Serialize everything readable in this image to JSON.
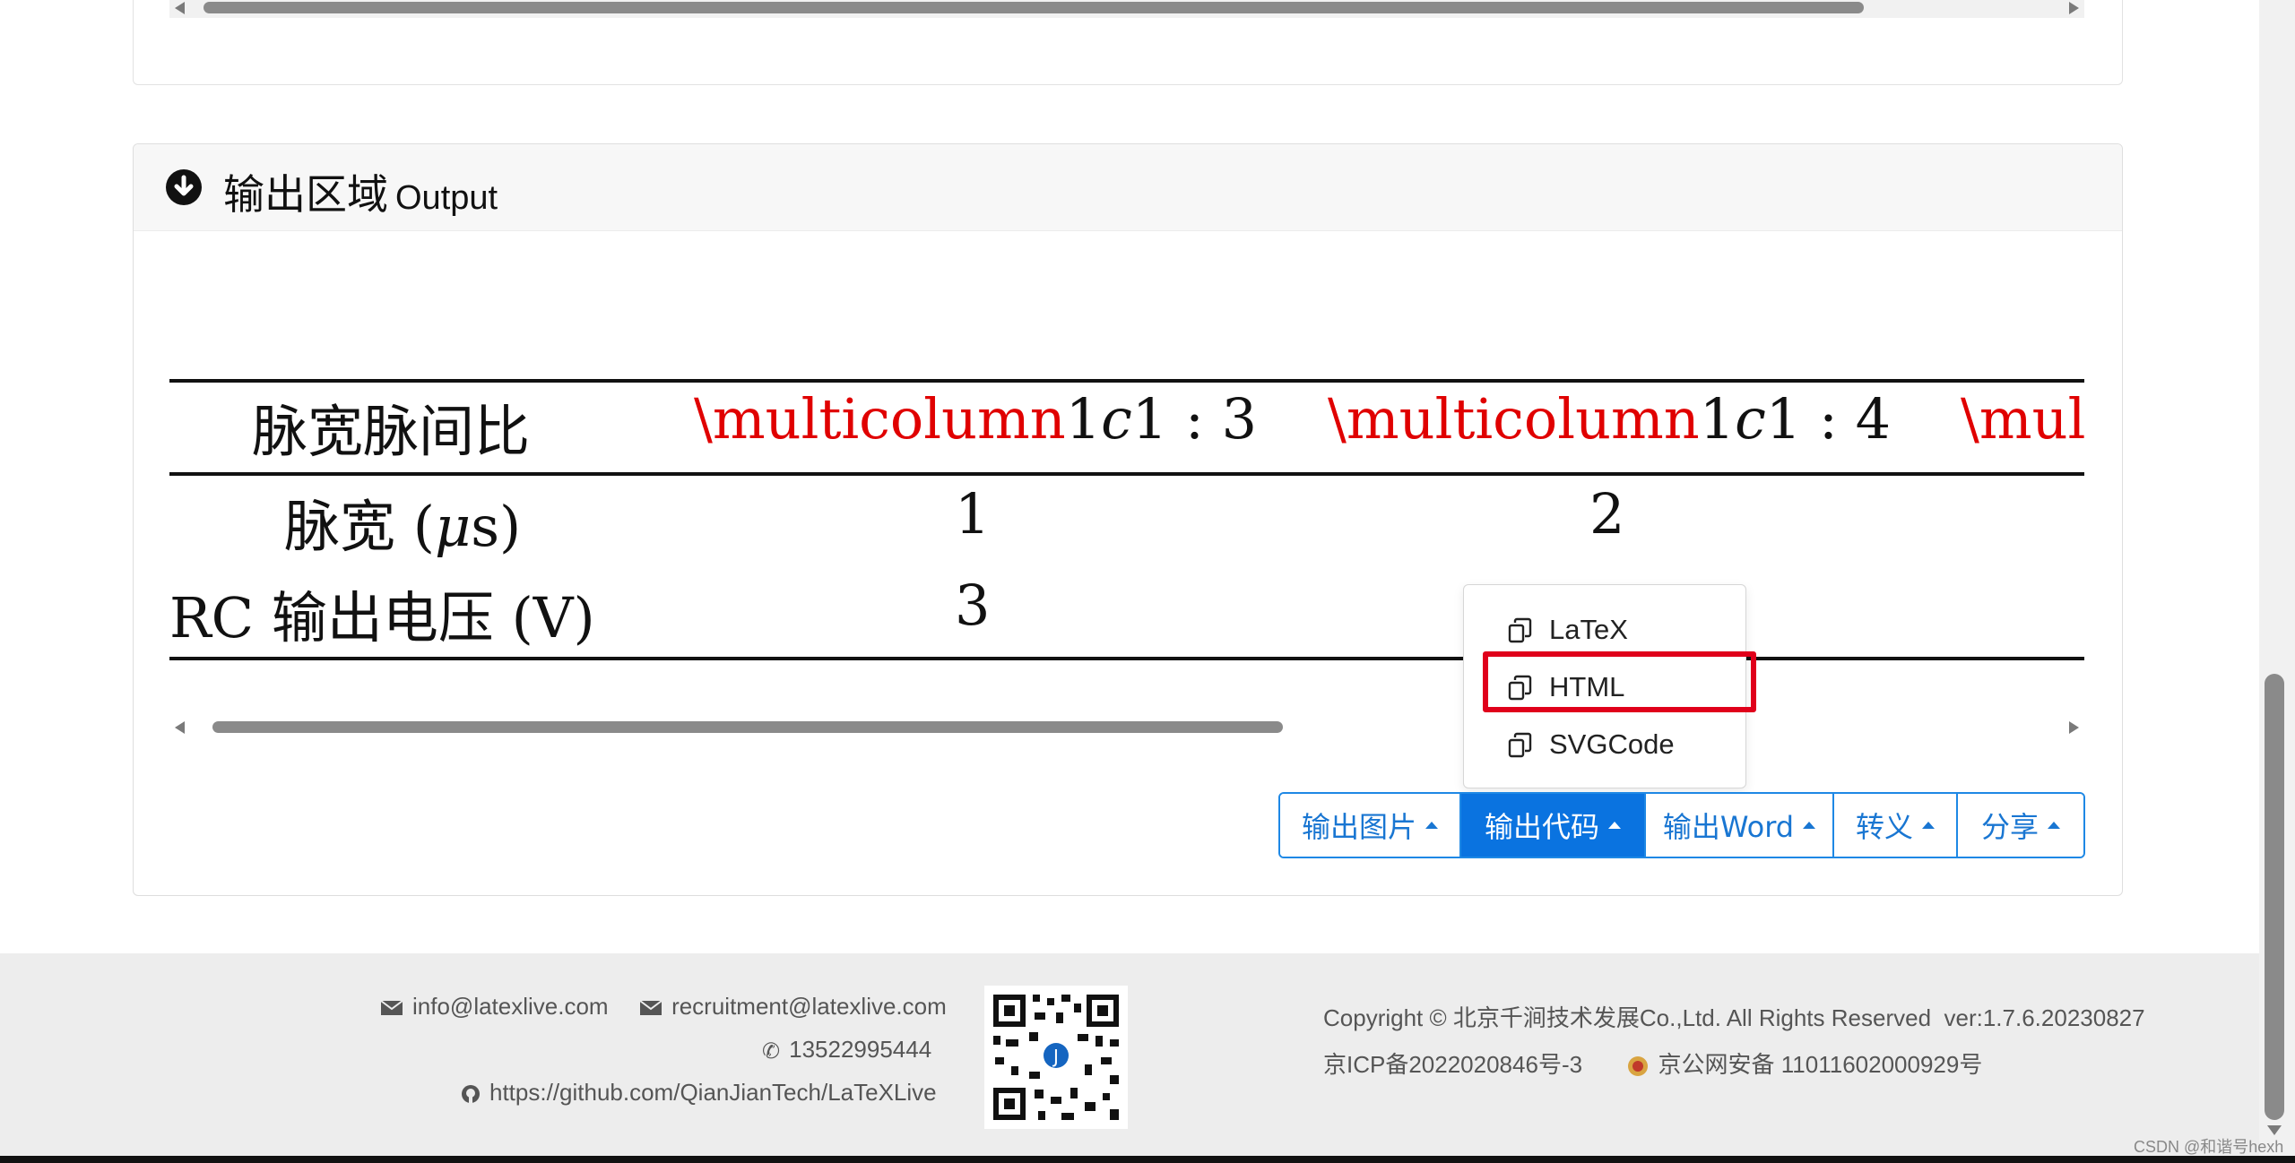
{
  "output_section": {
    "title_cn": "输出区域",
    "title_en": "Output"
  },
  "table": {
    "row1": {
      "label": "脉宽脉间比",
      "cell1_cmd": "\\multicolumn",
      "cell1_rest": "1",
      "cell1_c": "c",
      "cell1_ratio": "1 : 3",
      "cell2_cmd": "\\multicolumn",
      "cell2_rest": "1",
      "cell2_c": "c",
      "cell2_ratio": "1 : 4",
      "cell3_cmd": "\\mul"
    },
    "row2": {
      "label_cn": "脉宽",
      "label_unit_open": "(",
      "label_unit_mu": "μ",
      "label_unit_s": "s)",
      "v1": "1",
      "v2": "2"
    },
    "row3": {
      "label_rc": "RC",
      "label_cn": "输出电压",
      "label_unit": "(V)",
      "v1": "3"
    }
  },
  "dropdown": {
    "items": [
      {
        "label": "LaTeX"
      },
      {
        "label": "HTML"
      },
      {
        "label": "SVGCode"
      }
    ]
  },
  "toolbar": {
    "buttons": [
      {
        "label": "输出图片"
      },
      {
        "label": "输出代码"
      },
      {
        "label": "输出Word"
      },
      {
        "label": "转义"
      },
      {
        "label": "分享"
      }
    ]
  },
  "footer": {
    "email1": "info@latexlive.com",
    "email2": "recruitment@latexlive.com",
    "phone": "13522995444",
    "github": "https://github.com/QianJianTech/LaTeXLive",
    "copyright": "Copyright © 北京千涧技术发展Co.,Ltd. All Rights Reserved",
    "version": "ver:1.7.6.20230827",
    "icp": "京ICP备2022020846号-3",
    "police": "京公网安备 11011602000929号"
  },
  "watermark": "CSDN @和谐号hexh",
  "colors": {
    "accent": "#0a73e0",
    "highlight": "#e0001b",
    "latex_error": "#e00000"
  }
}
